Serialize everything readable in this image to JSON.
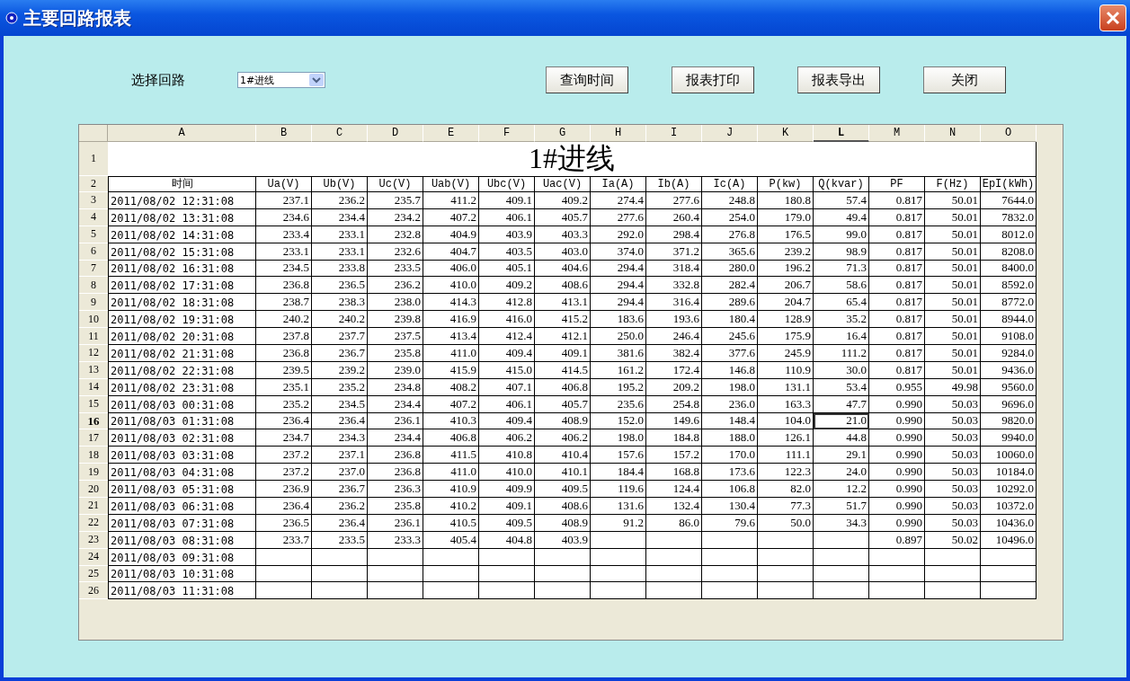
{
  "window": {
    "title": "主要回路报表"
  },
  "circuit_select": {
    "label": "选择回路",
    "value": "1#进线"
  },
  "buttons": [
    "查询时间",
    "报表打印",
    "报表导出",
    "关闭"
  ],
  "sheet": {
    "columns": [
      {
        "letter": "A",
        "selected": false
      },
      {
        "letter": "B",
        "selected": false
      },
      {
        "letter": "C",
        "selected": false
      },
      {
        "letter": "D",
        "selected": false
      },
      {
        "letter": "E",
        "selected": false
      },
      {
        "letter": "F",
        "selected": false
      },
      {
        "letter": "G",
        "selected": false
      },
      {
        "letter": "H",
        "selected": false
      },
      {
        "letter": "I",
        "selected": false
      },
      {
        "letter": "J",
        "selected": false
      },
      {
        "letter": "K",
        "selected": false
      },
      {
        "letter": "L",
        "selected": true
      },
      {
        "letter": "M",
        "selected": false
      },
      {
        "letter": "N",
        "selected": false
      },
      {
        "letter": "O",
        "selected": false
      }
    ],
    "title_row": {
      "number": "1",
      "text": "1#进线"
    },
    "header_row": {
      "number": "2",
      "cells": [
        "时间",
        "Ua(V)",
        "Ub(V)",
        "Uc(V)",
        "Uab(V)",
        "Ubc(V)",
        "Uac(V)",
        "Ia(A)",
        "Ib(A)",
        "Ic(A)",
        "P(kw)",
        "Q(kvar)",
        "PF",
        "F(Hz)",
        "EpI(kWh)"
      ]
    },
    "rows": [
      {
        "number": "3",
        "selected": false,
        "cells": [
          "2011/08/02 12:31:08",
          "237.1",
          "236.2",
          "235.7",
          "411.2",
          "409.1",
          "409.2",
          "274.4",
          "277.6",
          "248.8",
          "180.8",
          "57.4",
          "0.817",
          "50.01",
          "7644.0"
        ]
      },
      {
        "number": "4",
        "selected": false,
        "cells": [
          "2011/08/02 13:31:08",
          "234.6",
          "234.4",
          "234.2",
          "407.2",
          "406.1",
          "405.7",
          "277.6",
          "260.4",
          "254.0",
          "179.0",
          "49.4",
          "0.817",
          "50.01",
          "7832.0"
        ]
      },
      {
        "number": "5",
        "selected": false,
        "cells": [
          "2011/08/02 14:31:08",
          "233.4",
          "233.1",
          "232.8",
          "404.9",
          "403.9",
          "403.3",
          "292.0",
          "298.4",
          "276.8",
          "176.5",
          "99.0",
          "0.817",
          "50.01",
          "8012.0"
        ]
      },
      {
        "number": "6",
        "selected": false,
        "cells": [
          "2011/08/02 15:31:08",
          "233.1",
          "233.1",
          "232.6",
          "404.7",
          "403.5",
          "403.0",
          "374.0",
          "371.2",
          "365.6",
          "239.2",
          "98.9",
          "0.817",
          "50.01",
          "8208.0"
        ]
      },
      {
        "number": "7",
        "selected": false,
        "cells": [
          "2011/08/02 16:31:08",
          "234.5",
          "233.8",
          "233.5",
          "406.0",
          "405.1",
          "404.6",
          "294.4",
          "318.4",
          "280.0",
          "196.2",
          "71.3",
          "0.817",
          "50.01",
          "8400.0"
        ]
      },
      {
        "number": "8",
        "selected": false,
        "cells": [
          "2011/08/02 17:31:08",
          "236.8",
          "236.5",
          "236.2",
          "410.0",
          "409.2",
          "408.6",
          "294.4",
          "332.8",
          "282.4",
          "206.7",
          "58.6",
          "0.817",
          "50.01",
          "8592.0"
        ]
      },
      {
        "number": "9",
        "selected": false,
        "cells": [
          "2011/08/02 18:31:08",
          "238.7",
          "238.3",
          "238.0",
          "414.3",
          "412.8",
          "413.1",
          "294.4",
          "316.4",
          "289.6",
          "204.7",
          "65.4",
          "0.817",
          "50.01",
          "8772.0"
        ]
      },
      {
        "number": "10",
        "selected": false,
        "cells": [
          "2011/08/02 19:31:08",
          "240.2",
          "240.2",
          "239.8",
          "416.9",
          "416.0",
          "415.2",
          "183.6",
          "193.6",
          "180.4",
          "128.9",
          "35.2",
          "0.817",
          "50.01",
          "8944.0"
        ]
      },
      {
        "number": "11",
        "selected": false,
        "cells": [
          "2011/08/02 20:31:08",
          "237.8",
          "237.7",
          "237.5",
          "413.4",
          "412.4",
          "412.1",
          "250.0",
          "246.4",
          "245.6",
          "175.9",
          "16.4",
          "0.817",
          "50.01",
          "9108.0"
        ]
      },
      {
        "number": "12",
        "selected": false,
        "cells": [
          "2011/08/02 21:31:08",
          "236.8",
          "236.7",
          "235.8",
          "411.0",
          "409.4",
          "409.1",
          "381.6",
          "382.4",
          "377.6",
          "245.9",
          "111.2",
          "0.817",
          "50.01",
          "9284.0"
        ]
      },
      {
        "number": "13",
        "selected": false,
        "cells": [
          "2011/08/02 22:31:08",
          "239.5",
          "239.2",
          "239.0",
          "415.9",
          "415.0",
          "414.5",
          "161.2",
          "172.4",
          "146.8",
          "110.9",
          "30.0",
          "0.817",
          "50.01",
          "9436.0"
        ]
      },
      {
        "number": "14",
        "selected": false,
        "cells": [
          "2011/08/02 23:31:08",
          "235.1",
          "235.2",
          "234.8",
          "408.2",
          "407.1",
          "406.8",
          "195.2",
          "209.2",
          "198.0",
          "131.1",
          "53.4",
          "0.955",
          "49.98",
          "9560.0"
        ]
      },
      {
        "number": "15",
        "selected": false,
        "cells": [
          "2011/08/03 00:31:08",
          "235.2",
          "234.5",
          "234.4",
          "407.2",
          "406.1",
          "405.7",
          "235.6",
          "254.8",
          "236.0",
          "163.3",
          "47.7",
          "0.990",
          "50.03",
          "9696.0"
        ]
      },
      {
        "number": "16",
        "selected": true,
        "cells": [
          "2011/08/03 01:31:08",
          "236.4",
          "236.4",
          "236.1",
          "410.3",
          "409.4",
          "408.9",
          "152.0",
          "149.6",
          "148.4",
          "104.0",
          "21.0",
          "0.990",
          "50.03",
          "9820.0"
        ]
      },
      {
        "number": "17",
        "selected": false,
        "cells": [
          "2011/08/03 02:31:08",
          "234.7",
          "234.3",
          "234.4",
          "406.8",
          "406.2",
          "406.2",
          "198.0",
          "184.8",
          "188.0",
          "126.1",
          "44.8",
          "0.990",
          "50.03",
          "9940.0"
        ]
      },
      {
        "number": "18",
        "selected": false,
        "cells": [
          "2011/08/03 03:31:08",
          "237.2",
          "237.1",
          "236.8",
          "411.5",
          "410.8",
          "410.4",
          "157.6",
          "157.2",
          "170.0",
          "111.1",
          "29.1",
          "0.990",
          "50.03",
          "10060.0"
        ]
      },
      {
        "number": "19",
        "selected": false,
        "cells": [
          "2011/08/03 04:31:08",
          "237.2",
          "237.0",
          "236.8",
          "411.0",
          "410.0",
          "410.1",
          "184.4",
          "168.8",
          "173.6",
          "122.3",
          "24.0",
          "0.990",
          "50.03",
          "10184.0"
        ]
      },
      {
        "number": "20",
        "selected": false,
        "cells": [
          "2011/08/03 05:31:08",
          "236.9",
          "236.7",
          "236.3",
          "410.9",
          "409.9",
          "409.5",
          "119.6",
          "124.4",
          "106.8",
          "82.0",
          "12.2",
          "0.990",
          "50.03",
          "10292.0"
        ]
      },
      {
        "number": "21",
        "selected": false,
        "cells": [
          "2011/08/03 06:31:08",
          "236.4",
          "236.2",
          "235.8",
          "410.2",
          "409.1",
          "408.6",
          "131.6",
          "132.4",
          "130.4",
          "77.3",
          "51.7",
          "0.990",
          "50.03",
          "10372.0"
        ]
      },
      {
        "number": "22",
        "selected": false,
        "cells": [
          "2011/08/03 07:31:08",
          "236.5",
          "236.4",
          "236.1",
          "410.5",
          "409.5",
          "408.9",
          "91.2",
          "86.0",
          "79.6",
          "50.0",
          "34.3",
          "0.990",
          "50.03",
          "10436.0"
        ]
      },
      {
        "number": "23",
        "selected": false,
        "cells": [
          "2011/08/03 08:31:08",
          "233.7",
          "233.5",
          "233.3",
          "405.4",
          "404.8",
          "403.9",
          null,
          null,
          null,
          null,
          null,
          "0.897",
          "50.02",
          "10496.0"
        ]
      },
      {
        "number": "24",
        "selected": false,
        "cells": [
          "2011/08/03 09:31:08"
        ]
      },
      {
        "number": "25",
        "selected": false,
        "cells": [
          "2011/08/03 10:31:08"
        ]
      },
      {
        "number": "26",
        "selected": false,
        "cells": [
          "2011/08/03 11:31:08"
        ]
      }
    ]
  }
}
